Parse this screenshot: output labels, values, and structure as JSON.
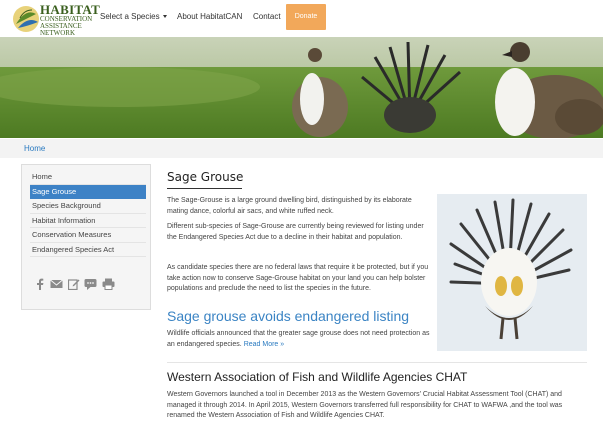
{
  "logo": {
    "line1": "HABITAT",
    "line2": "CONSERVATION",
    "line3": "ASSISTANCE",
    "line4": "NETWORK"
  },
  "nav": {
    "select_species": "Select a Species",
    "about": "About HabitatCAN",
    "contact": "Contact",
    "donate": "Donate"
  },
  "breadcrumb": {
    "home": "Home"
  },
  "sidebar": {
    "items": [
      {
        "label": "Home",
        "active": false
      },
      {
        "label": "Sage Grouse",
        "active": true
      },
      {
        "label": "Species Background",
        "active": false
      },
      {
        "label": "Habitat Information",
        "active": false
      },
      {
        "label": "Conservation Measures",
        "active": false
      },
      {
        "label": "Endangered Species Act",
        "active": false
      }
    ],
    "share_icons": [
      "facebook-icon",
      "email-icon",
      "edit-icon",
      "comment-icon",
      "print-icon"
    ]
  },
  "main": {
    "title": "Sage Grouse",
    "p1": "The Sage-Grouse is a large ground dwelling bird, distinguished by its elaborate mating dance, colorful air sacs, and white ruffed neck.",
    "p2": "Different sub-species of Sage-Grouse are currently being reviewed for listing under the Endangered Species Act due to a decline in their habitat and population.",
    "p3": "As candidate species there are no federal laws that require it be protected, but if you take action now to conserve Sage-Grouse habitat on your land you can help bolster populations and preclude the need to list the species in the future.",
    "news_headline": "Sage grouse avoids endangered listing",
    "p4": "Wildlife officials announced that the greater sage grouse does not need protection as an endangered species.",
    "read_more": "Read More »",
    "section_title": "Western Association of Fish and Wildlife Agencies CHAT",
    "p5": "Western Governors launched a tool in December 2013 as the Western Governors' Crucial Habitat Assessment Tool (CHAT) and managed it through 2014. In April 2015, Western Governors transferred full responsibility for CHAT to WAFWA ,and the tool was renamed the Western Association of Fish and Wildlife Agencies CHAT."
  },
  "colors": {
    "accent_blue": "#3d82c6",
    "donate_orange": "#f2a85a",
    "logo_green": "#3a5f1e"
  }
}
